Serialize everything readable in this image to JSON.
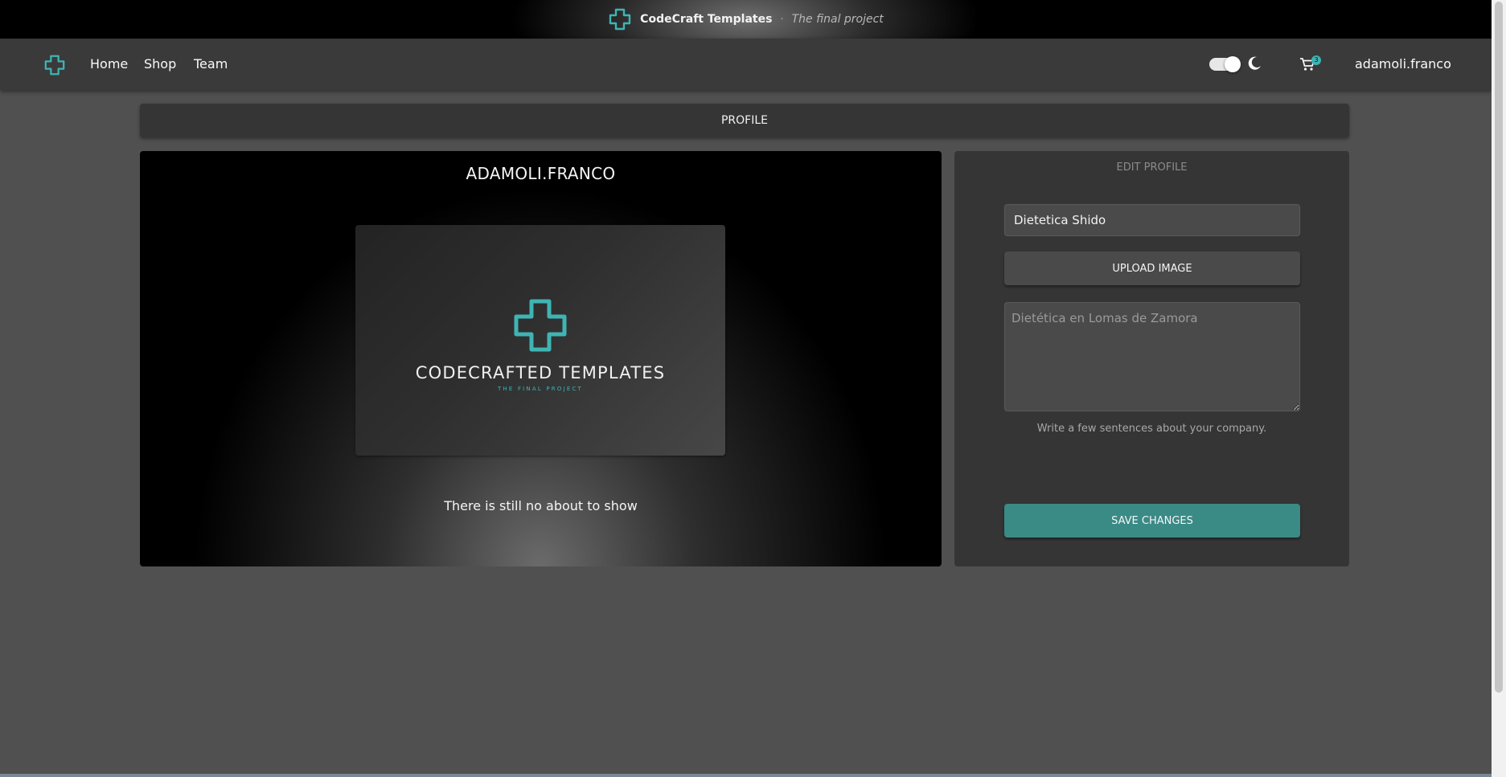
{
  "banner": {
    "title": "CodeCraft Templates",
    "separator": "·",
    "subtitle": "The final project"
  },
  "navbar": {
    "links": [
      "Home",
      "Shop",
      "Team"
    ],
    "theme_toggle_on": true,
    "cart_count": "3",
    "username": "adamoli.franco"
  },
  "profile_header": "PROFILE",
  "profile_card": {
    "name": "ADAMOLI.FRANCO",
    "image": {
      "brand_name": "CODECRAFTED TEMPLATES",
      "tagline": "THE FINAL PROJECT"
    },
    "about_text": "There is still no about to show"
  },
  "edit_profile": {
    "title": "EDIT PROFILE",
    "company_name_value": "Dietetica Shido",
    "upload_label": "UPLOAD IMAGE",
    "about_placeholder": "Dietética en Lomas de Zamora",
    "helper_text": "Write a few sentences about your company.",
    "save_label": "SAVE CHANGES"
  },
  "colors": {
    "accent": "#3fb4b4",
    "save_button": "#3a8a86",
    "page_bg": "#505050",
    "navbar_bg": "#3a3a3a",
    "panel_bg": "#353535"
  },
  "icons": {
    "logo": "cross-logo-icon",
    "theme": "moon-icon",
    "cart": "cart-icon"
  }
}
